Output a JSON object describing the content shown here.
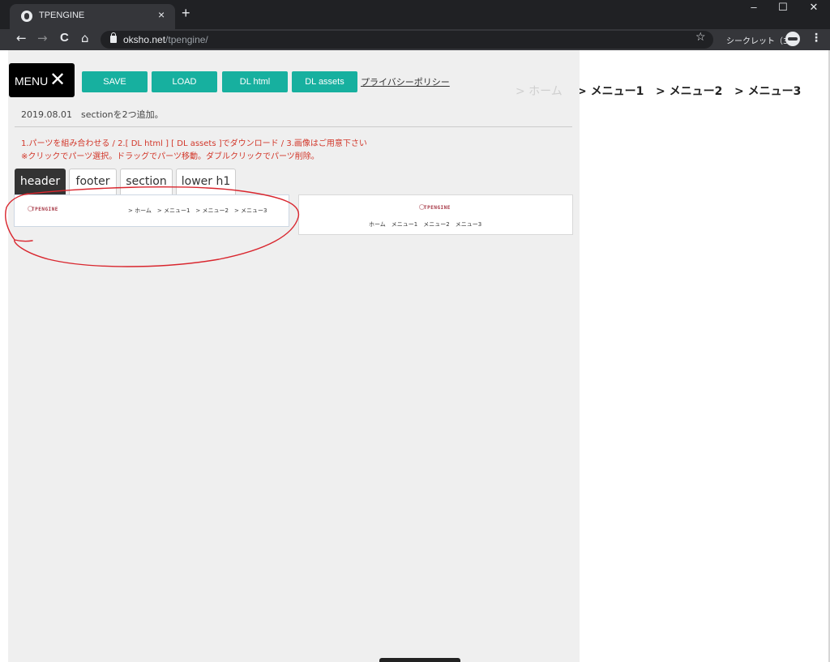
{
  "browser": {
    "tab_title": "TPENGINE",
    "tab_close": "×",
    "new_tab": "+",
    "minimize": "–",
    "maximize": "☐",
    "close": "✕",
    "back": "←",
    "forward": "→",
    "reload": "C",
    "home": "⌂",
    "url_host": "oksho.net",
    "url_path": "/tpengine/",
    "bookmark": "☆",
    "incognito_label": "シークレット（3）",
    "menu": "⋮"
  },
  "app": {
    "menu_label": "MENU",
    "menu_close": "✕",
    "buttons": [
      {
        "label": "SAVE"
      },
      {
        "label": "LOAD"
      },
      {
        "label": "DL html"
      },
      {
        "label": "DL assets"
      }
    ],
    "privacy_link": "プライバシーポリシー",
    "background_nav": [
      "> ホーム",
      "> メニュー1",
      "> メニュー2",
      "> メニュー3"
    ],
    "news": "2019.08.01　sectionを2つ追加。",
    "instructions": [
      "1.パーツを組み合わせる / 2.[ DL html ] [ DL assets ]でダウンロード / 3.画像はご用意下さい",
      "※クリックでパーツ選択。ドラッグでパーツ移動。ダブルクリックでパーツ削除。"
    ],
    "part_tabs": [
      {
        "label": "header",
        "active": true
      },
      {
        "label": "footer",
        "active": false
      },
      {
        "label": "section",
        "active": false
      },
      {
        "label": "lower h1",
        "active": false
      }
    ],
    "parts": [
      {
        "logo": "TPENGINE",
        "nav": "> ホーム　> メニュー1　> メニュー2　> メニュー3"
      },
      {
        "logo": "TPENGINE",
        "nav": "ホーム　メニュー1　メニュー2　メニュー3"
      }
    ],
    "annotation_color": "#d9262e"
  }
}
